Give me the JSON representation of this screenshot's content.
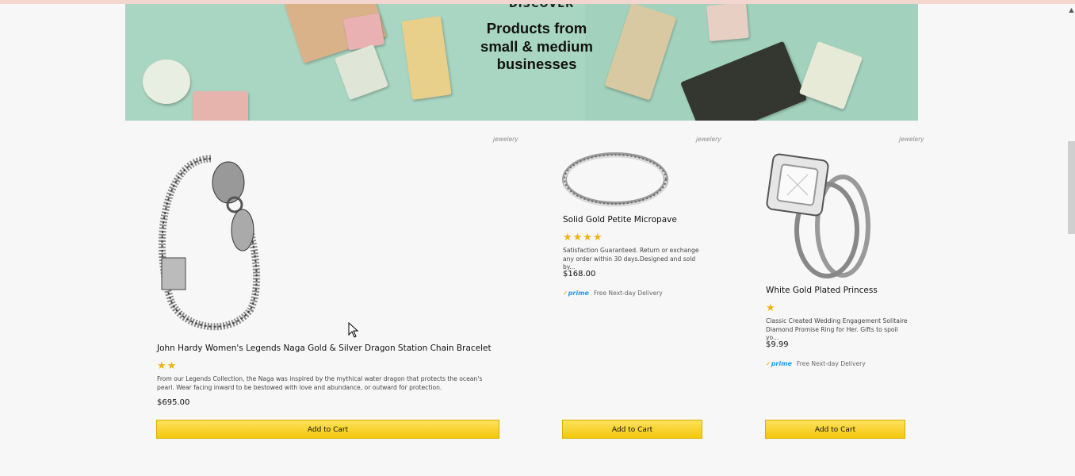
{
  "banner": {
    "kicker": "DISCOVER",
    "headline": "Products from small & medium businesses"
  },
  "products": [
    {
      "category": "jewelery",
      "title": "John Hardy Women's Legends Naga Gold & Silver Dragon Station Chain Bracelet",
      "rating_stars": 2,
      "stars_text": "★★",
      "description": "From our Legends Collection, the Naga was inspired by the mythical water dragon that protects the ocean's pearl. Wear facing inward to be bestowed with love and abundance, or outward for protection.",
      "price": "$695.00",
      "cta": "Add to Cart"
    },
    {
      "category": "jewelery",
      "title": "Solid Gold Petite Micropave",
      "rating_stars": 4,
      "stars_text": "★★★★",
      "description": "Satisfaction Guaranteed. Return or exchange any order within 30 days.Designed and sold by...",
      "price": "$168.00",
      "prime_logo": "prime",
      "delivery": "Free Next-day Delivery",
      "cta": "Add to Cart"
    },
    {
      "category": "jewelery",
      "title": "White Gold Plated Princess",
      "rating_stars": 1,
      "stars_text": "★",
      "description": "Classic Created Wedding Engagement Solitaire Diamond Promise Ring for Her. Gifts to spoil yo...",
      "price": "$9.99",
      "prime_logo": "prime",
      "delivery": "Free Next-day Delivery",
      "cta": "Add to Cart"
    }
  ],
  "colors": {
    "banner_bg": "#a9d6c2",
    "star": "#f0b318",
    "button_top": "#fde15a",
    "button_bottom": "#f4c70d",
    "prime_blue": "#1a98ff"
  },
  "icons": [
    "scroll-up-arrow-icon",
    "mouse-cursor-icon",
    "prime-check-icon"
  ]
}
